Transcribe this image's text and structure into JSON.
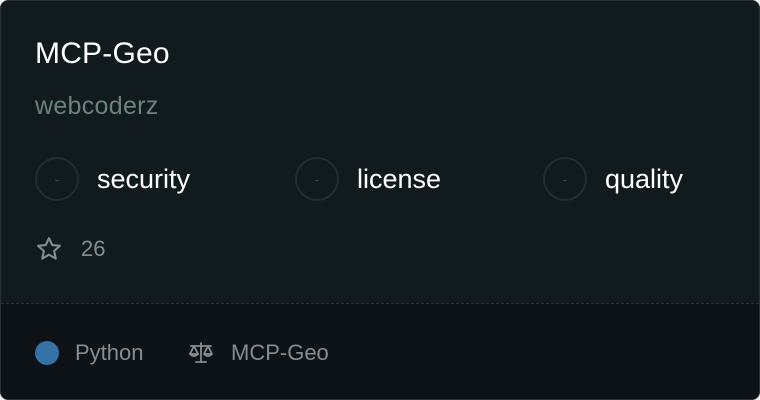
{
  "card": {
    "title": "MCP-Geo",
    "owner": "webcoderz"
  },
  "scores": [
    {
      "label": "security",
      "value": "-",
      "icon": "security-score-circle"
    },
    {
      "label": "license",
      "value": "-",
      "icon": "license-score-circle"
    },
    {
      "label": "quality",
      "value": "-",
      "icon": "quality-score-circle"
    }
  ],
  "stars": {
    "icon": "star-icon",
    "count": "26"
  },
  "footer": {
    "language": {
      "name": "Python",
      "color": "#3572a5"
    },
    "license": {
      "icon": "scale-icon",
      "name": "MCP-Geo"
    }
  },
  "colors": {
    "background": "#111a1d",
    "footer_background": "#0d1316",
    "owner_text": "#6a837b",
    "muted_text": "#868c90"
  }
}
